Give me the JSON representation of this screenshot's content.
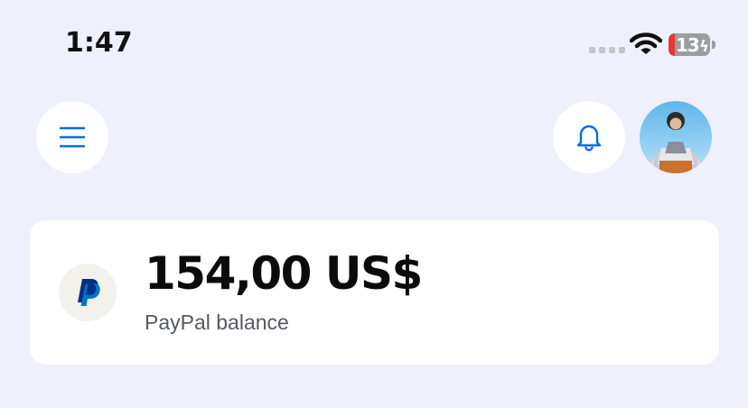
{
  "status_bar": {
    "time": "1:47",
    "battery_percent": "13",
    "icons": [
      "cellular-signal-icon",
      "wifi-icon",
      "battery-charging-icon"
    ]
  },
  "header": {
    "menu_icon": "hamburger-menu-icon",
    "notifications_icon": "bell-icon",
    "avatar": "profile-avatar"
  },
  "balance_card": {
    "logo": "paypal-logo",
    "amount": "154,00 US$",
    "label": "PayPal balance"
  },
  "colors": {
    "background": "#eef1fb",
    "accent": "#0070e0",
    "card": "#ffffff",
    "battery_low": "#e53935"
  }
}
